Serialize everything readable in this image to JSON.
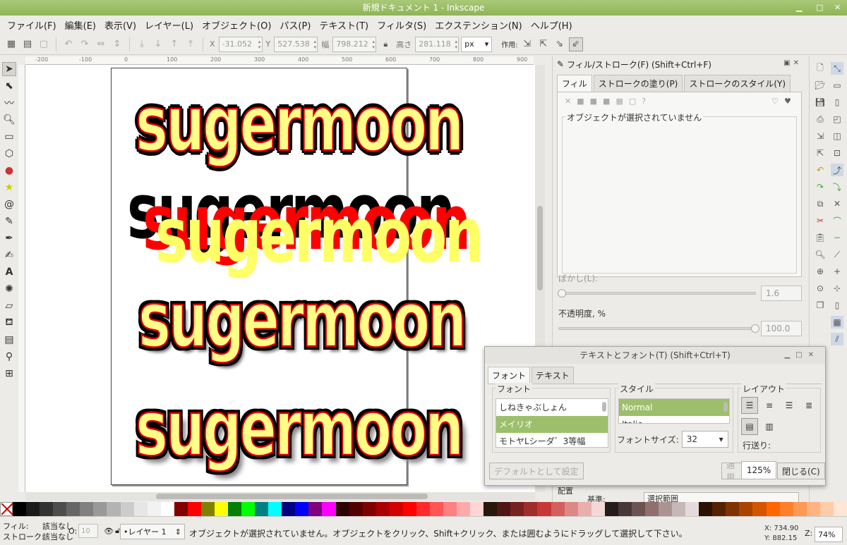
{
  "window": {
    "title": "新規ドキュメント 1 - Inkscape"
  },
  "menu": [
    "ファイル(F)",
    "編集(E)",
    "表示(V)",
    "レイヤー(L)",
    "オブジェクト(O)",
    "パス(P)",
    "テキスト(T)",
    "フィルタ(S)",
    "エクステンション(N)",
    "ヘルプ(H)"
  ],
  "toolbar": {
    "x_label": "X",
    "x_value": "-31.052",
    "y_label": "Y",
    "y_value": "527.538",
    "w_label": "幅",
    "w_value": "798.212",
    "h_label": "高さ",
    "h_value": "281.118",
    "unit": "px",
    "act_label": "作用:"
  },
  "ruler": {
    "marks": [
      "-200",
      "-100",
      "0",
      "100",
      "200",
      "300",
      "400",
      "500",
      "600",
      "700",
      "800",
      "900"
    ]
  },
  "canvas": {
    "logo_text": "sugermoon"
  },
  "fill_panel": {
    "title": "フィル/ストローク(F) (Shift+Ctrl+F)",
    "tabs": [
      "フィル",
      "ストロークの塗り(P)",
      "ストロークのスタイル(Y)"
    ],
    "no_selection": "オブジェクトが選択されていません",
    "blur_label": "ぼかし(L):",
    "blur_value": "1.6",
    "opacity_label": "不透明度, %",
    "opacity_value": "100.0"
  },
  "text_dialog": {
    "title": "テキストとフォント(T) (Shift+Ctrl+T)",
    "tabs": [
      "フォント",
      "テキスト"
    ],
    "font_group": "フォント",
    "fonts": [
      "しねきゃぶしょん",
      "メイリオ",
      "モトヤLシーダ゛3等幅"
    ],
    "style_group": "スタイル",
    "styles": [
      "Normal",
      "Italic"
    ],
    "font_size_label": "フォントサイズ:",
    "font_size": "32",
    "layout_group": "レイアウト",
    "line_spacing_label": "行送り:",
    "line_spacing": "125%",
    "default_btn": "デフォルトとして設定",
    "apply_btn": "適用",
    "close_btn": "閉じる(C)"
  },
  "below_dialog": {
    "heading": "配置",
    "basis_label": "基準:",
    "basis_value": "選択範囲"
  },
  "palette": [
    "#000000",
    "#1a1a1a",
    "#333333",
    "#4d4d4d",
    "#666666",
    "#808080",
    "#999999",
    "#b3b3b3",
    "#cccccc",
    "#e6e6e6",
    "#f2f2f2",
    "#ffffff",
    "#800000",
    "#ff0000",
    "#808000",
    "#ffff00",
    "#008000",
    "#00ff00",
    "#008080",
    "#00ffff",
    "#000080",
    "#0000ff",
    "#800080",
    "#ff00ff",
    "#2b0000",
    "#550000",
    "#800000",
    "#aa0000",
    "#d40000",
    "#ff0000",
    "#ff2a2a",
    "#ff5555",
    "#ff8080",
    "#ffaaaa",
    "#ffd5d5",
    "#28170b",
    "#501616",
    "#782121",
    "#a02c2c",
    "#c83737",
    "#d35f5f",
    "#de8787",
    "#e9afaf",
    "#f4d7d7",
    "#241c1c",
    "#483737",
    "#6c5353",
    "#916f6f",
    "#ac9393",
    "#c8b7b7",
    "#e3dbdb",
    "#2b1100",
    "#552200",
    "#803300",
    "#aa4400",
    "#d45500",
    "#ff6600",
    "#ff7f2a",
    "#ff9955",
    "#ffb380",
    "#ffccaa",
    "#ffe6d5"
  ],
  "status": {
    "fill_label": "フィル:",
    "fill_value": "該当なし",
    "stroke_label": "ストローク:",
    "stroke_value": "該当なし",
    "opacity_label": "O:",
    "opacity_value": "10",
    "layer": "•レイヤー 1",
    "message": "オブジェクトが選択されていません。オブジェクトをクリック、Shift+クリック、または囲むようにドラッグして選択して下さい。",
    "x_label": "X:",
    "x_value": "734.90",
    "y_label": "Y:",
    "y_value": "882.15",
    "zoom_label": "Z:",
    "zoom_value": "74%"
  }
}
